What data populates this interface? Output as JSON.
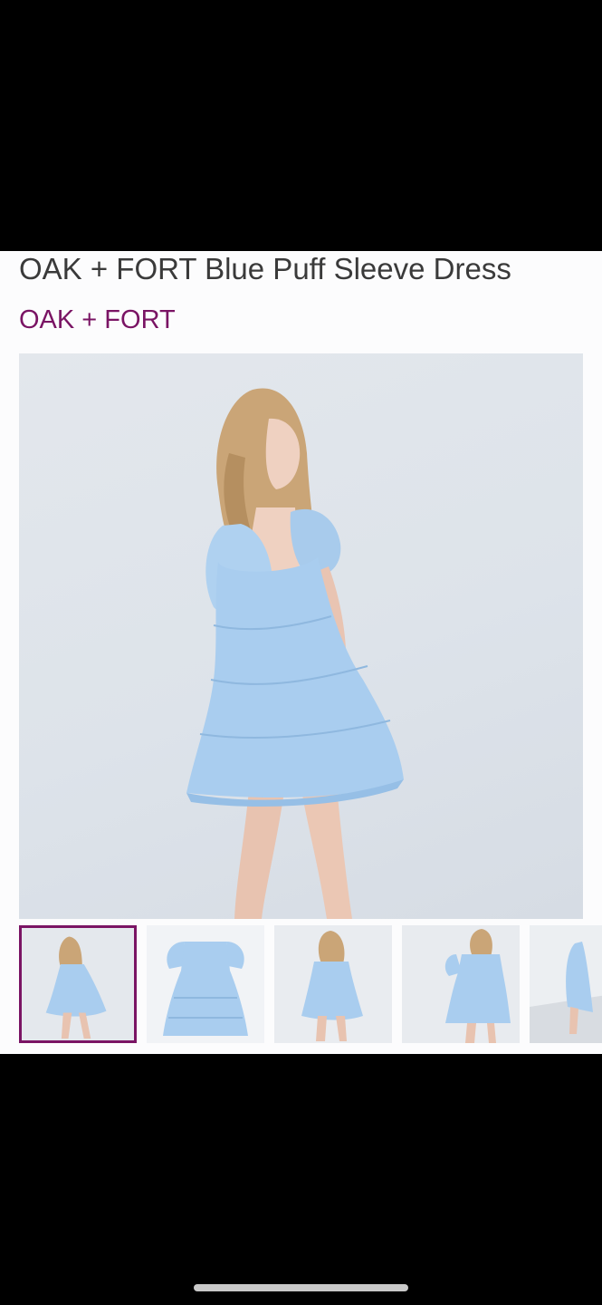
{
  "product": {
    "title": "OAK + FORT Blue Puff Sleeve Dress",
    "brand": "OAK + FORT"
  },
  "gallery": {
    "main_image_icon": "dress-photo-icon",
    "selected_index": 0,
    "thumbnails": [
      {
        "icon": "dress-model-side-icon",
        "selected": true
      },
      {
        "icon": "dress-flatlay-icon",
        "selected": false
      },
      {
        "icon": "dress-model-back-icon",
        "selected": false
      },
      {
        "icon": "dress-model-front-icon",
        "selected": false
      },
      {
        "icon": "dress-model-partial-icon",
        "selected": false
      }
    ]
  },
  "colors": {
    "brand_accent": "#7a1464",
    "title_text": "#3a3a3a",
    "dress_blue": "#a9cdef",
    "background": "#fcfcfd"
  }
}
